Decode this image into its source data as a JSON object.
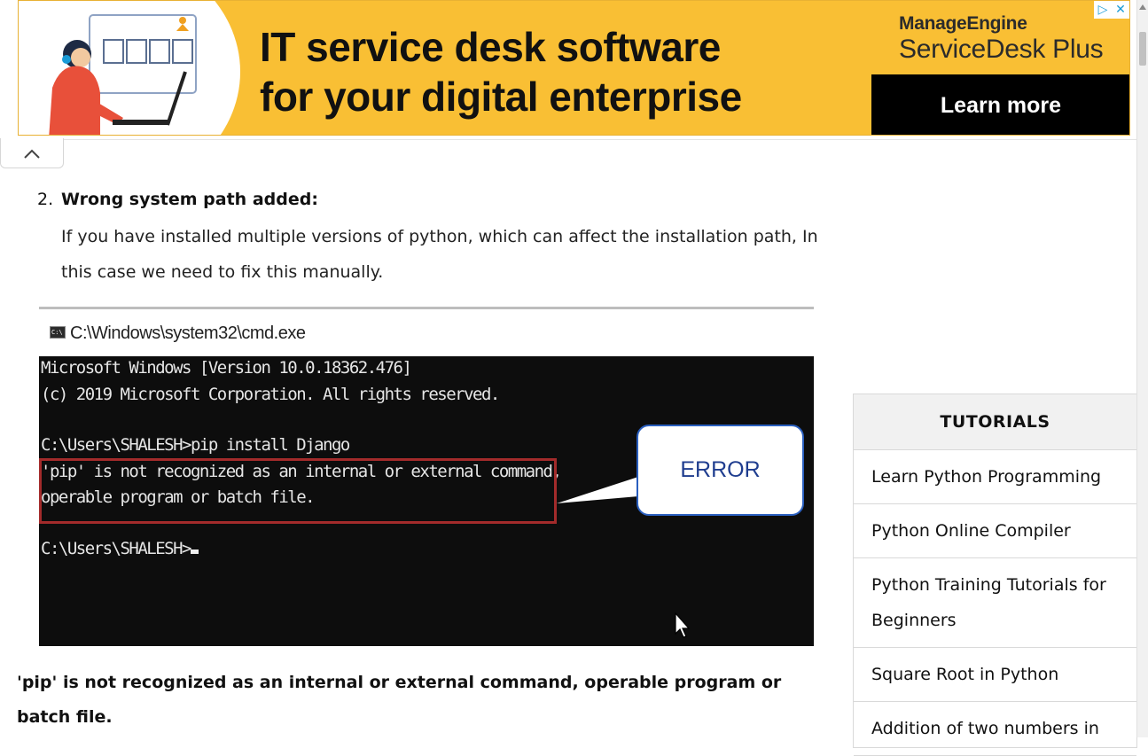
{
  "ad": {
    "headline_line1": "IT service desk software",
    "headline_line2": "for your digital enterprise",
    "brand_top": "ManageEngine",
    "brand_bottom": "ServiceDesk Plus",
    "cta": "Learn more",
    "colors": {
      "background": "#f9bf34",
      "cta_bg": "#000000",
      "adchoices": "#1a9bd7"
    },
    "icons": [
      "adchoices-icon",
      "close-icon"
    ]
  },
  "collapse_icon": "chevron-up-icon",
  "article": {
    "item_number": "2.",
    "item_heading": "Wrong system path added:",
    "item_text": "If you have installed multiple versions of python, which can affect the installation path, In this case we need to fix this manually.",
    "figure": {
      "title": "C:\\Windows\\system32\\cmd.exe",
      "lines": [
        "Microsoft Windows [Version 10.0.18362.476]",
        "(c) 2019 Microsoft Corporation. All rights reserved.",
        "C:\\Users\\SHALESH>pip install Django",
        "'pip' is not recognized as an internal or external command,",
        "operable program or batch file.",
        "C:\\Users\\SHALESH>"
      ],
      "callout": "ERROR",
      "colors": {
        "terminal_bg": "#0d0d0d",
        "error_border": "#a32b2b",
        "callout_text": "#1f3d8f"
      }
    },
    "caption": "'pip' is not recognized as an internal or external command, operable program or batch file."
  },
  "sidebar": {
    "title": "TUTORIALS",
    "items": [
      "Learn Python Programming",
      "Python Online Compiler",
      "Python Training Tutorials for Beginners",
      "Square Root in Python",
      "Addition of two numbers in"
    ]
  }
}
